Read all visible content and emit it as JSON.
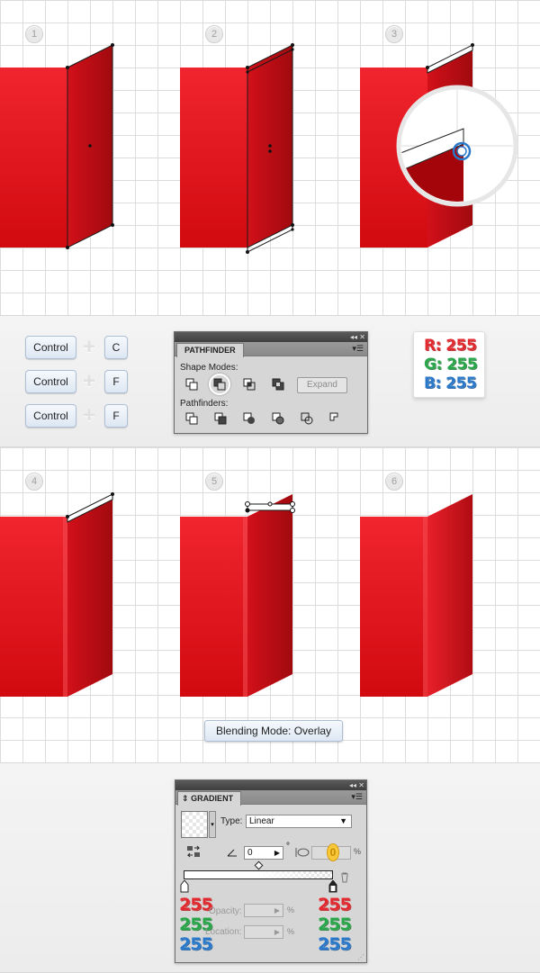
{
  "steps": [
    "1",
    "2",
    "3",
    "4",
    "5",
    "6"
  ],
  "shortcuts": [
    {
      "modifier": "Control",
      "key": "C"
    },
    {
      "modifier": "Control",
      "key": "F"
    },
    {
      "modifier": "Control",
      "key": "F"
    }
  ],
  "pathfinder": {
    "title": "PATHFINDER",
    "shape_modes_label": "Shape Modes:",
    "expand_label": "Expand",
    "pathfinders_label": "Pathfinders:"
  },
  "rgb": {
    "r": "R: 255",
    "g": "G: 255",
    "b": "B: 255"
  },
  "blending_mode": "Blending Mode: Overlay",
  "gradient": {
    "title": "GRADIENT",
    "type_label": "Type:",
    "type_value": "Linear",
    "angle_value": "0",
    "degree_symbol": "°",
    "aspect_badge": "0",
    "percent": "%",
    "opacity_label": "Opacity:",
    "location_label": "Location:",
    "left_stop": {
      "r": "255",
      "g": "255",
      "b": "255"
    },
    "right_stop": {
      "r": "255",
      "g": "255",
      "b": "255"
    }
  },
  "colors": {
    "red_front_top": "#f0252e",
    "red_front_bottom": "#d10a10",
    "red_side_light": "#d2101a",
    "red_side_dark": "#a00a0e",
    "red_text": "#e02a2f",
    "green_text": "#2aa64a",
    "blue_text": "#2a78c9"
  }
}
